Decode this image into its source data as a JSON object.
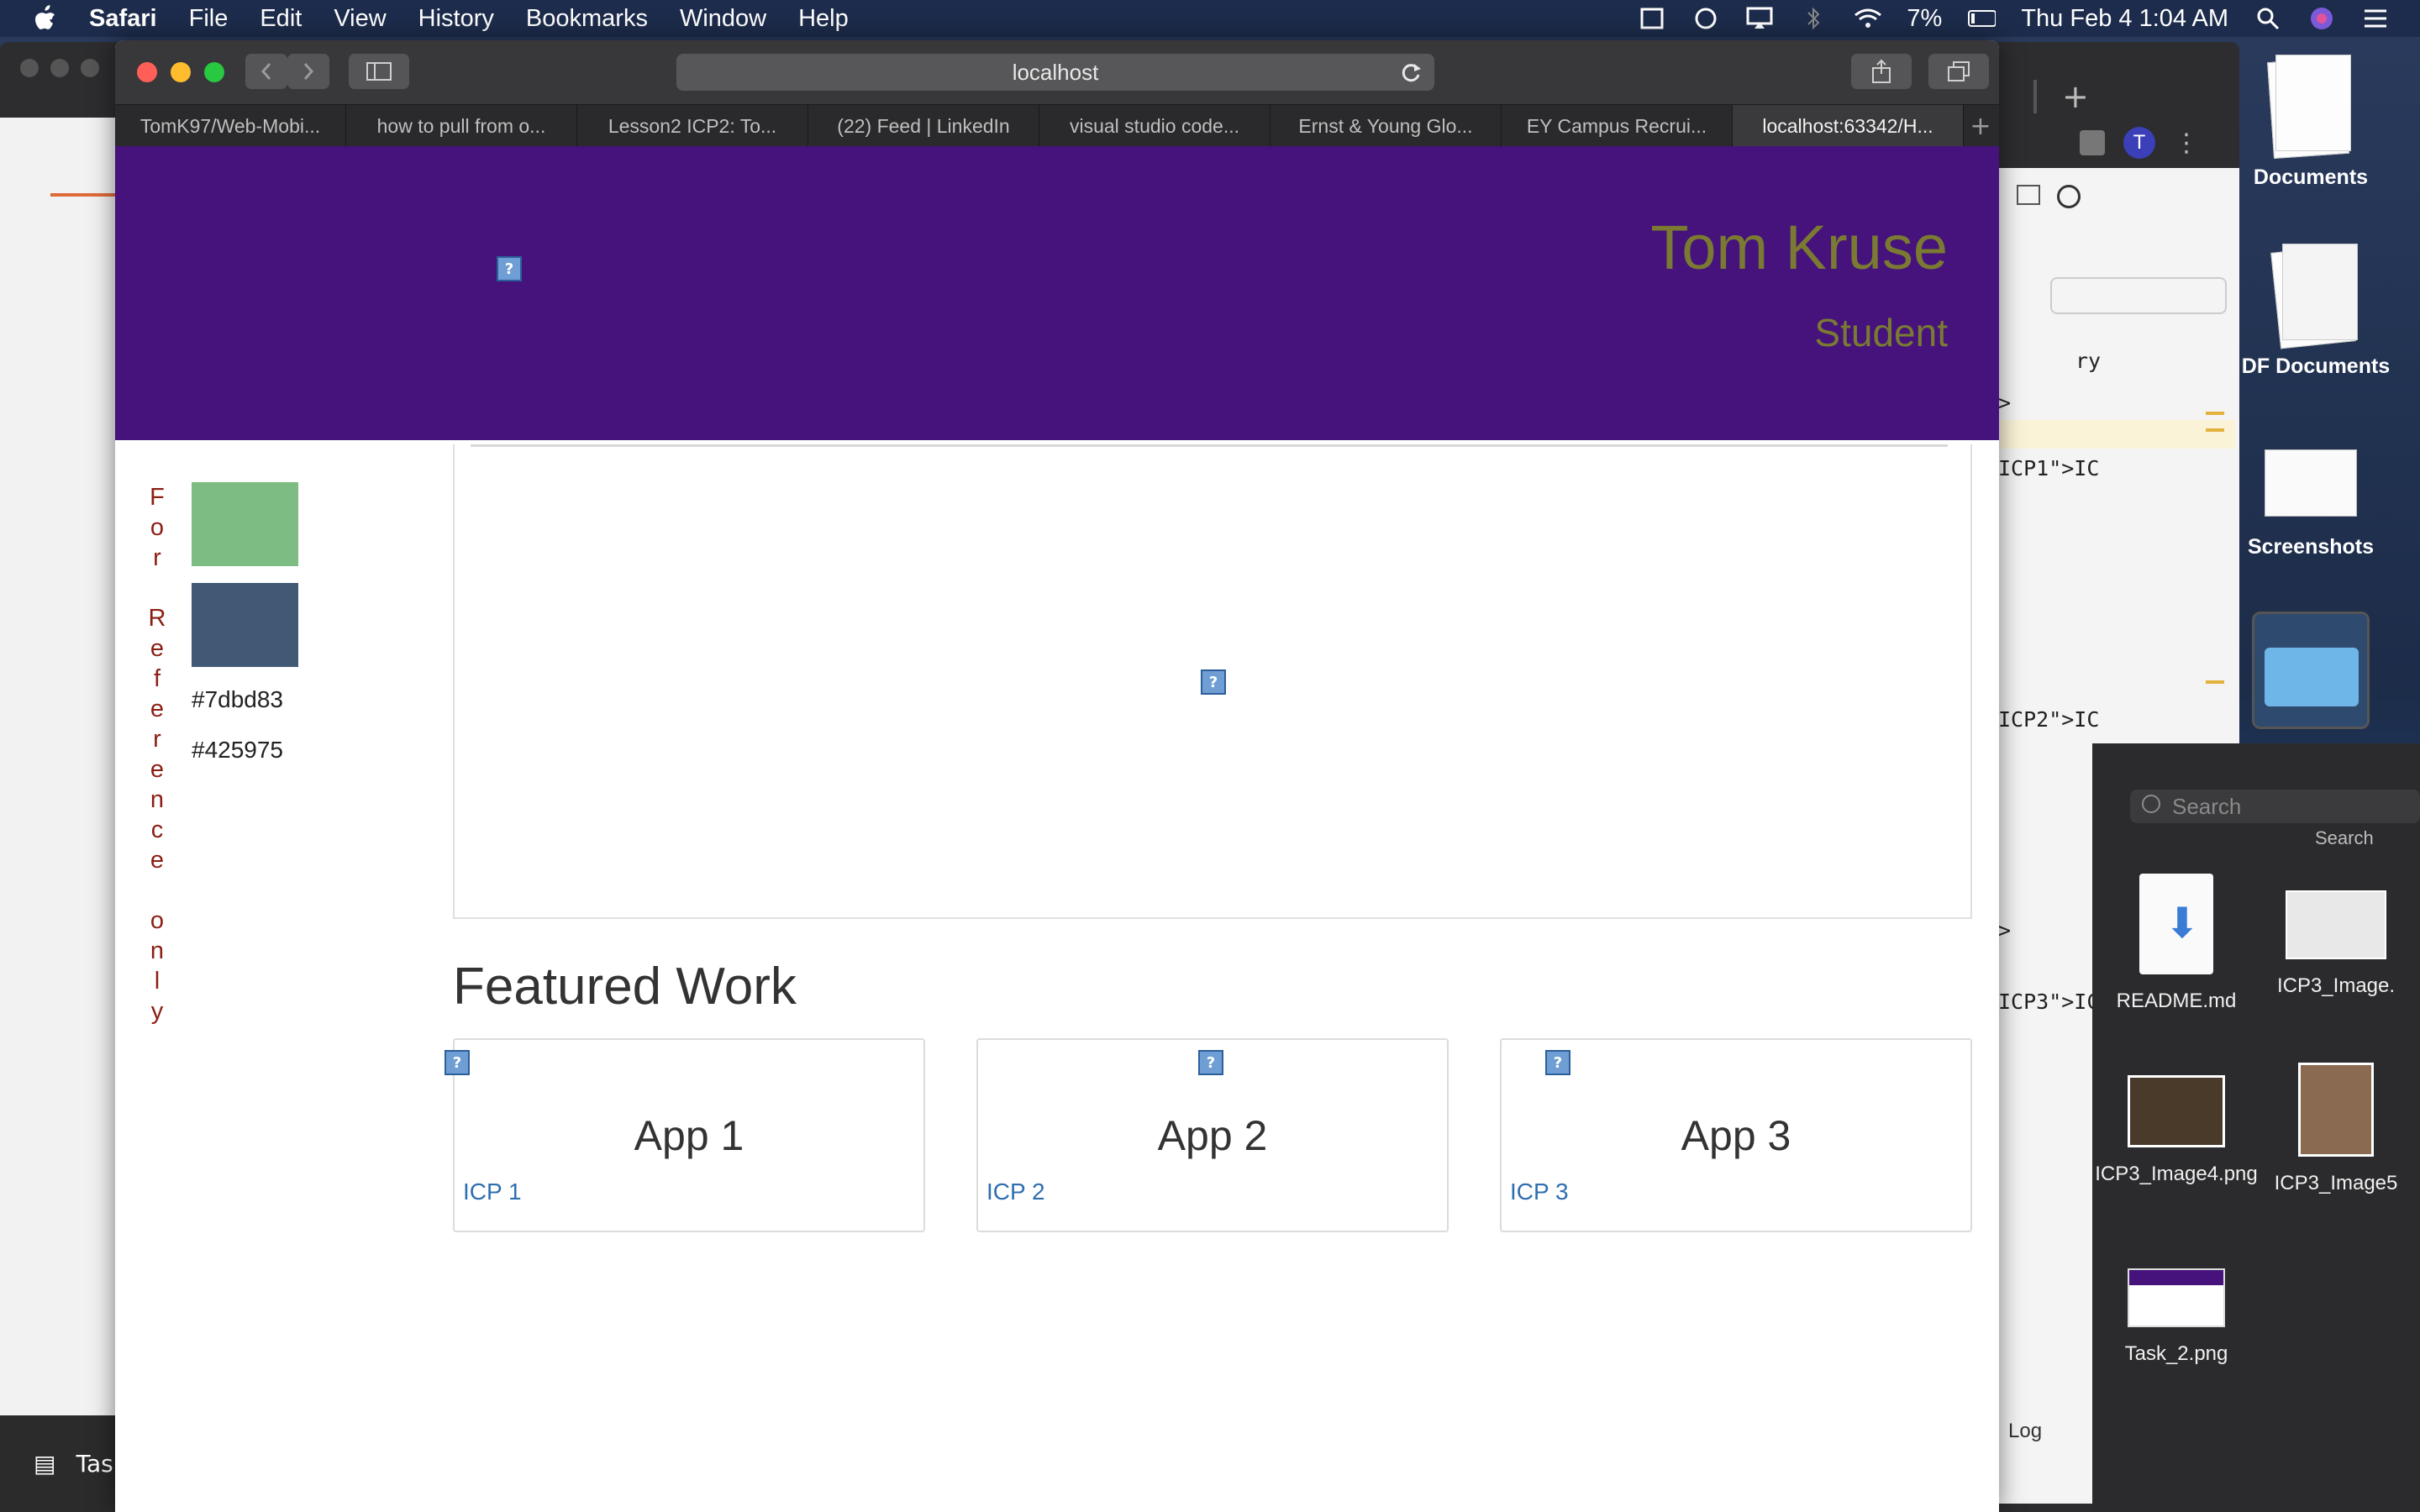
{
  "menubar": {
    "app_name": "Safari",
    "menus": [
      "File",
      "Edit",
      "View",
      "History",
      "Bookmarks",
      "Window",
      "Help"
    ],
    "battery": "7%",
    "clock": "Thu Feb 4  1:04 AM"
  },
  "safari": {
    "url": "localhost",
    "tabs": [
      "TomK97/Web-Mobi...",
      "how to pull from o...",
      "Lesson2 ICP2: To...",
      "(22) Feed | LinkedIn",
      "visual studio code...",
      "Ernst & Young Glo...",
      "EY Campus Recrui...",
      "localhost:63342/H..."
    ],
    "new_tab_symbol": "+"
  },
  "page": {
    "header": {
      "name": "Tom Kruse",
      "role": "Student",
      "name_color": "#7a7a32",
      "bg_color": "#45137b"
    },
    "reference_text": "For Reference only",
    "swatches": [
      {
        "color": "#7dbd83",
        "label": "#7dbd83"
      },
      {
        "color": "#425975",
        "label": "#425975"
      }
    ],
    "featured_title": "Featured Work",
    "cards": [
      {
        "title": "App 1",
        "link": "ICP 1"
      },
      {
        "title": "App 2",
        "link": "ICP 2"
      },
      {
        "title": "App 3",
        "link": "ICP 3"
      }
    ],
    "broken_image_glyph": "?"
  },
  "desktop": {
    "icons": [
      {
        "label": "Documents"
      },
      {
        "label": "DF Documents"
      },
      {
        "label": "Screenshots"
      }
    ]
  },
  "finder": {
    "search_placeholder": "Search",
    "search_label": "Search",
    "files": [
      {
        "name": "README.md"
      },
      {
        "name": "ICP3_Image."
      },
      {
        "name": "ICP3_Image4.png"
      },
      {
        "name": "ICP3_Image5"
      },
      {
        "name": "Task_2.png"
      }
    ]
  },
  "ide": {
    "lines": [
      "ry",
      ">",
      "ICP1\">IC",
      "ICP2\">IC",
      ">",
      "ICP3\">IC"
    ],
    "status": "Log"
  },
  "taskbar": {
    "label": "Tas"
  }
}
